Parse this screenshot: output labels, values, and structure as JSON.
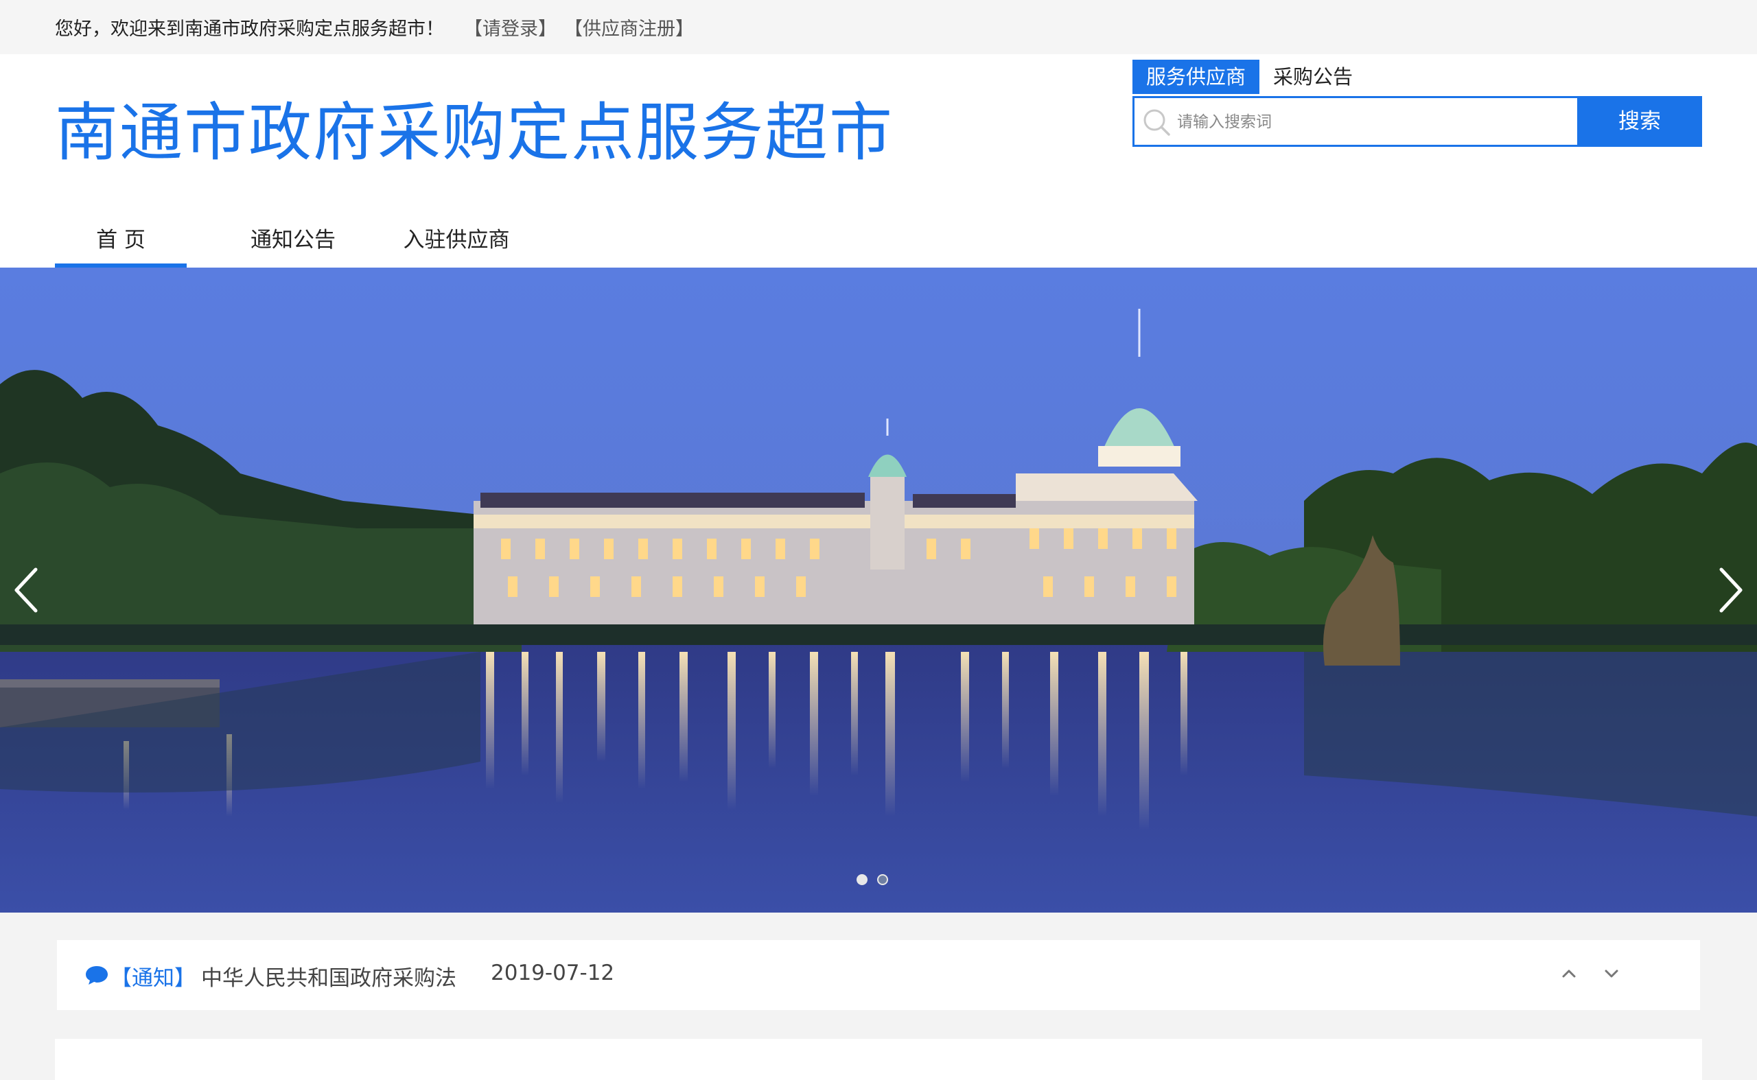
{
  "topbar": {
    "welcome": "您好，欢迎来到南通市政府采购定点服务超市！",
    "login_link": "【请登录】",
    "register_link": "【供应商注册】"
  },
  "header": {
    "site_title": "南通市政府采购定点服务超市",
    "search_tabs": [
      "服务供应商",
      "采购公告"
    ],
    "search_placeholder": "请输入搜索词",
    "search_button": "搜索"
  },
  "nav": {
    "items": [
      "首 页",
      "通知公告",
      "入驻供应商"
    ],
    "active_index": 0
  },
  "carousel": {
    "slide_count": 2,
    "active_slide": 0
  },
  "notice": {
    "tag": "【通知】",
    "title": "中华人民共和国政府采购法",
    "date": "2019-07-12"
  },
  "colors": {
    "accent": "#1a73e8",
    "page_bg": "#f3f3f3"
  },
  "icons": {
    "search": "search-icon",
    "prev": "chevron-left-icon",
    "next": "chevron-right-icon",
    "notice": "chat-bubble-icon",
    "scroll_up": "chevron-up-icon",
    "scroll_down": "chevron-down-icon"
  }
}
